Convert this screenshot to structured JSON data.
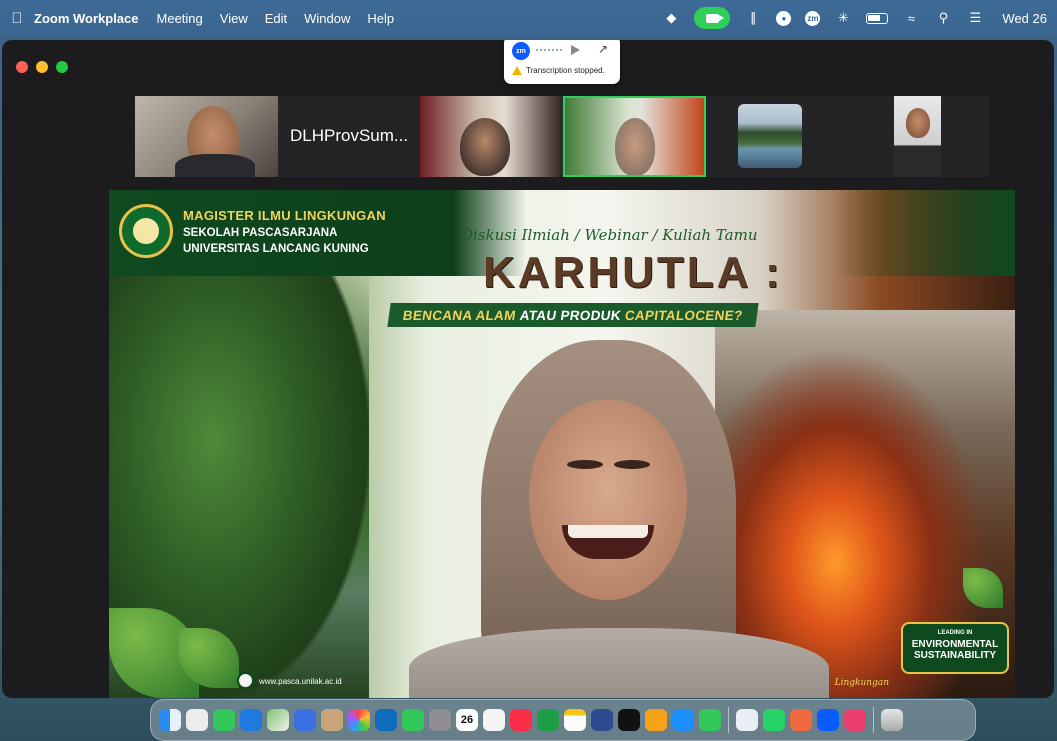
{
  "menubar": {
    "app_name": "Zoom Workplace",
    "menus": [
      "Meeting",
      "View",
      "Edit",
      "Window",
      "Help"
    ],
    "date": "Wed 26"
  },
  "transcription": {
    "logo": "zm",
    "message": "Transcription stopped."
  },
  "thumbnails": {
    "participant_name": "DLHProvSum..."
  },
  "slide": {
    "institution_line1": "MAGISTER ILMU LINGKUNGAN",
    "institution_line2": "SEKOLAH PASCASARJANA",
    "institution_line3": "UNIVERSITAS LANCANG KUNING",
    "event_type": "Diskusi Ilmiah / Webinar / Kuliah Tamu",
    "title": "KARHUTLA :",
    "subtitle_part1": "BENCANA ALAM",
    "subtitle_part2": "ATAU PRODUK",
    "subtitle_part3": "CAPITALOCENE?",
    "badge_line1": "LEADING IN",
    "badge_line2": "ENVIRONMENTAL",
    "badge_line3": "SUSTAINABILITY",
    "website": "www.pasca.unilak.ac.id",
    "footer_text": "Lingkungan"
  },
  "dock": {
    "calendar_day": "26",
    "apps": [
      "finder-icon",
      "launchpad-icon",
      "messages-icon",
      "safari-icon",
      "maps-icon",
      "keynote-icon",
      "contacts-icon",
      "photos-icon",
      "outlook-icon",
      "facetime-icon",
      "system-settings-icon",
      "calendar-icon",
      "reminders-icon",
      "music-icon",
      "numbers-icon",
      "notes-icon",
      "freeform-icon",
      "apple-tv-icon",
      "pages-icon",
      "app-store-icon",
      "activity-monitor-icon",
      "zoom-icon",
      "whatsapp-icon",
      "perplexity-icon",
      "zoom-meeting-icon",
      "screenshot-icon",
      "trash-icon"
    ]
  }
}
